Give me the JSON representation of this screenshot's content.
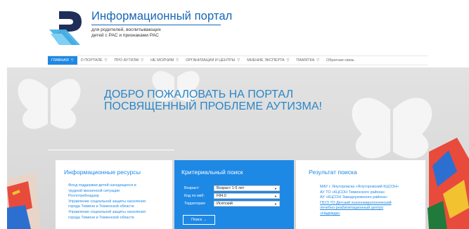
{
  "header": {
    "title": "Информационный портал",
    "subtitle_line1": "для родителей, воспитывающих",
    "subtitle_line2": "детей с РАС и признаками РАС"
  },
  "nav": {
    "items": [
      {
        "label": "ГЛАВНАЯ",
        "active": true,
        "has_dropdown": true
      },
      {
        "label": "О ПОРТАЛЕ",
        "has_dropdown": true
      },
      {
        "label": "ПРО АУТИЗМ",
        "has_dropdown": true
      },
      {
        "label": "НЕ МОЛЧИМ",
        "has_dropdown": true
      },
      {
        "label": "ОРГАНИЗАЦИИ И ЦЕНТРЫ",
        "has_dropdown": true
      },
      {
        "label": "МНЕНИЕ ЭКСПЕРТА",
        "has_dropdown": true
      },
      {
        "label": "ПАМЯТКА",
        "has_dropdown": true
      },
      {
        "label": "Обратная связь",
        "has_dropdown": false
      }
    ],
    "chevron": "▽"
  },
  "hero": {
    "line1": "ДОБРО ПОЖАЛОВАТЬ НА ПОРТАЛ",
    "line2": "ПОСВЯЩЕННЫЙ ПРОБЛЕМЕ АУТИЗМА!"
  },
  "info_resources": {
    "title": "Информационные ресурсы",
    "items": [
      "Фонд поддержки детей находящихся в",
      "трудной жизненной ситуации",
      "Роспотребнадзор",
      "Управление социальной защиты населения",
      "города Тюмени и Тюменской области",
      "Управление социальной защиты населения",
      "города Тюмени и Тюменской области"
    ]
  },
  "criteria_search": {
    "title": "Критериальный поиск",
    "fields": [
      {
        "label": "Возраст:",
        "value": "Возраст 1-5 лет"
      },
      {
        "label": "Код по мкб:",
        "value": "F84.0"
      },
      {
        "label": "Территория:",
        "value": "Исетский"
      }
    ],
    "dropdown_arrow": "▼",
    "button_label": "Поиск →"
  },
  "search_results": {
    "title": "Результат поиска",
    "items": [
      {
        "text": "МАУ г. Ялуторовска «Ялуторовский КЦСОН»",
        "link": false
      },
      {
        "text": "АУ ТО «КЦСОН Тюменского района»",
        "link": false
      },
      {
        "text": "АУ «КЦСОН Заводоуковского района»",
        "link": false
      },
      {
        "text": "ГБУЗ ТО Детский психоневрологический",
        "link": true
      },
      {
        "text": "лечебно-реабилитационный центро",
        "link": true
      },
      {
        "text": "«Надежда»",
        "link": true
      }
    ]
  },
  "colors": {
    "brand_blue": "#1565b5",
    "accent_blue": "#1e88e5",
    "logo_dark": "#1f2f5a",
    "logo_light": "#4ab3e8",
    "hero_text": "#2b86c6"
  },
  "icons": [
    "logo-mark",
    "butterfly-icon",
    "painted-hand-icon",
    "chevron-down-icon"
  ]
}
